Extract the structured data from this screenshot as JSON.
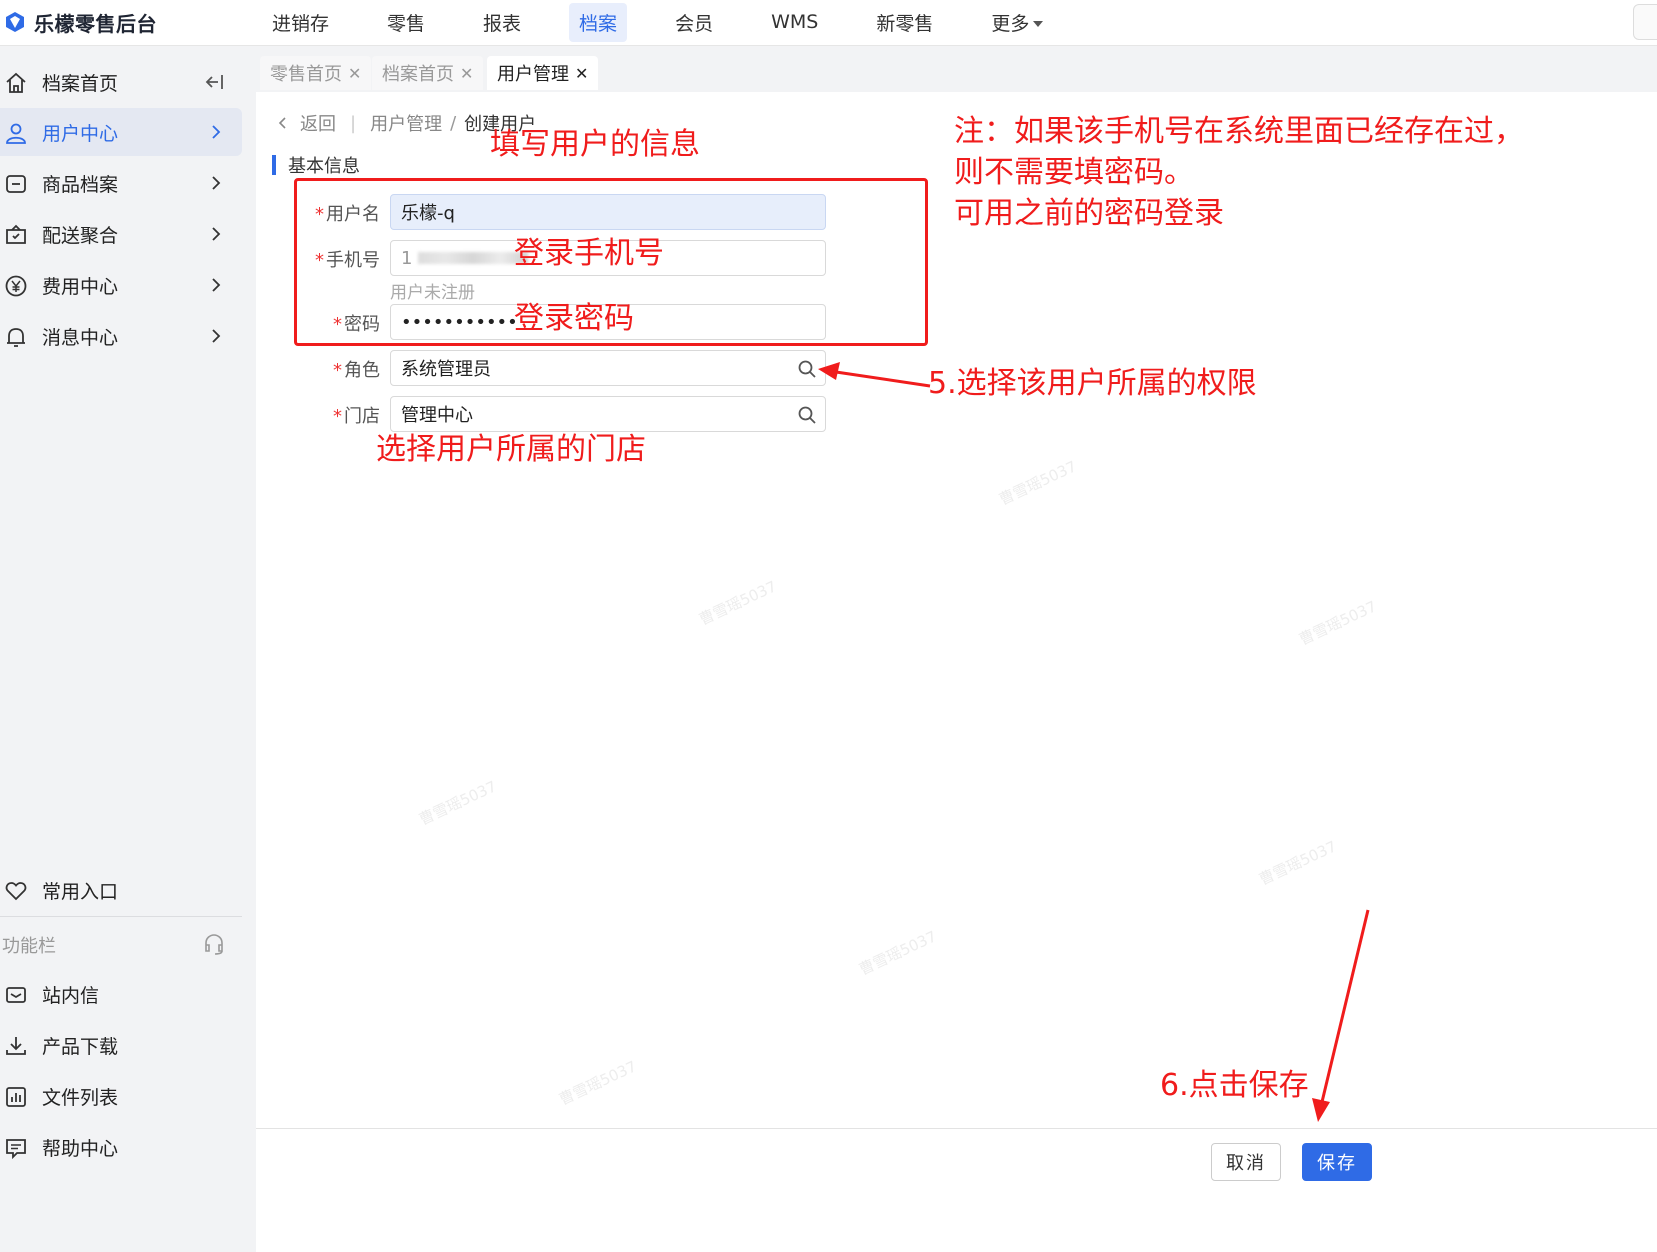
{
  "app": {
    "brand": "乐檬零售后台"
  },
  "topnav": {
    "items": [
      "进销存",
      "零售",
      "报表",
      "档案",
      "会员",
      "WMS",
      "新零售",
      "更多"
    ],
    "active_index": 3
  },
  "sidebar": {
    "items": [
      {
        "label": "档案首页",
        "icon": "home-icon"
      },
      {
        "label": "用户中心",
        "icon": "user-icon",
        "active": true
      },
      {
        "label": "商品档案",
        "icon": "product-icon"
      },
      {
        "label": "配送聚合",
        "icon": "delivery-icon"
      },
      {
        "label": "费用中心",
        "icon": "yuan-icon"
      },
      {
        "label": "消息中心",
        "icon": "bell-icon"
      }
    ],
    "favorites_label": "常用入口",
    "section_label": "功能栏",
    "tools": [
      {
        "label": "站内信",
        "icon": "mail-icon"
      },
      {
        "label": "产品下载",
        "icon": "download-icon"
      },
      {
        "label": "文件列表",
        "icon": "chart-file-icon"
      },
      {
        "label": "帮助中心",
        "icon": "help-icon"
      }
    ]
  },
  "tabs": [
    {
      "label": "零售首页",
      "active": false
    },
    {
      "label": "档案首页",
      "active": false
    },
    {
      "label": "用户管理",
      "active": true
    }
  ],
  "breadcrumb": {
    "back": "返回",
    "parent": "用户管理",
    "current": "创建用户"
  },
  "form": {
    "section_title": "基本信息",
    "username_label": "用户名",
    "username_value": "乐檬-q",
    "phone_label": "手机号",
    "phone_value": "1",
    "phone_hint": "用户未注册",
    "password_label": "密码",
    "password_value": "•••••••••••",
    "role_label": "角色",
    "role_value": "系统管理员",
    "store_label": "门店",
    "store_value": "管理中心"
  },
  "footer": {
    "cancel": "取消",
    "save": "保存"
  },
  "watermark": "曹雪瑶5037",
  "annotations": {
    "fill_info": "填写用户的信息",
    "login_phone": "登录手机号",
    "login_password": "登录密码",
    "note_line1": "注：如果该手机号在系统里面已经存在过，",
    "note_line2": "则不需要填密码。",
    "note_line3": "可用之前的密码登录",
    "step5": "5.选择该用户所属的权限",
    "select_store": "选择用户所属的门店",
    "step6": "6.点击保存"
  },
  "colors": {
    "accent": "#2f6be6",
    "annotation": "#f01c1c",
    "sidebar_bg": "#f2f3f5"
  }
}
